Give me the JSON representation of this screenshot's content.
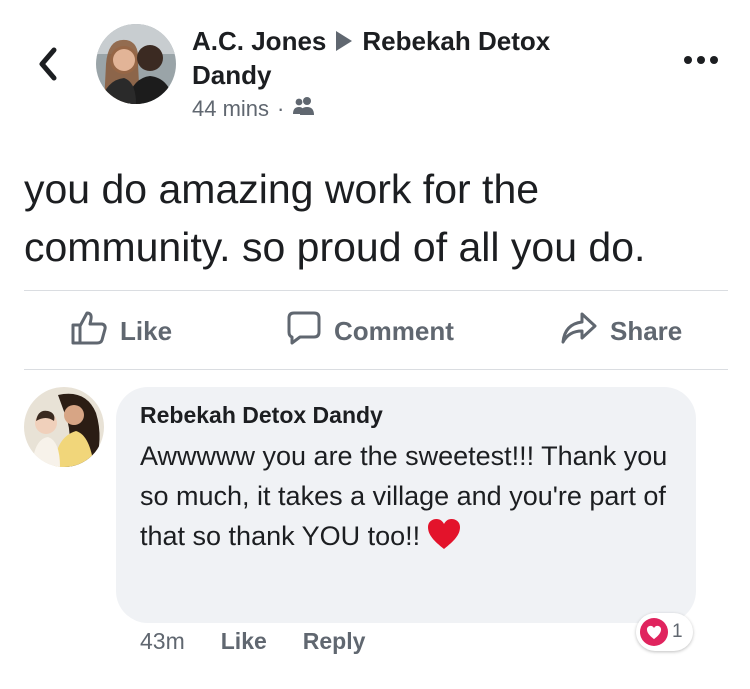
{
  "post": {
    "author": "A.C. Jones",
    "target": "Rebekah Detox Dandy",
    "time": "44 mins",
    "separator": "·",
    "audience_icon": "friends-icon",
    "text": "you do amazing work for the community.  so proud of all you do."
  },
  "actions": {
    "like": "Like",
    "comment": "Comment",
    "share": "Share"
  },
  "comment": {
    "author": "Rebekah Detox Dandy",
    "text": "Awwwww you are the sweetest!!! Thank you so much, it takes a village and you're part of that so thank YOU too!!",
    "time": "43m",
    "like": "Like",
    "reply": "Reply",
    "reaction_count": "1",
    "reaction_icon": "love-reaction-icon"
  },
  "colors": {
    "text": "#1c1e21",
    "secondary": "#606770",
    "bubble": "#f0f2f5",
    "divider": "#dadde1",
    "love": "#e0245e"
  }
}
